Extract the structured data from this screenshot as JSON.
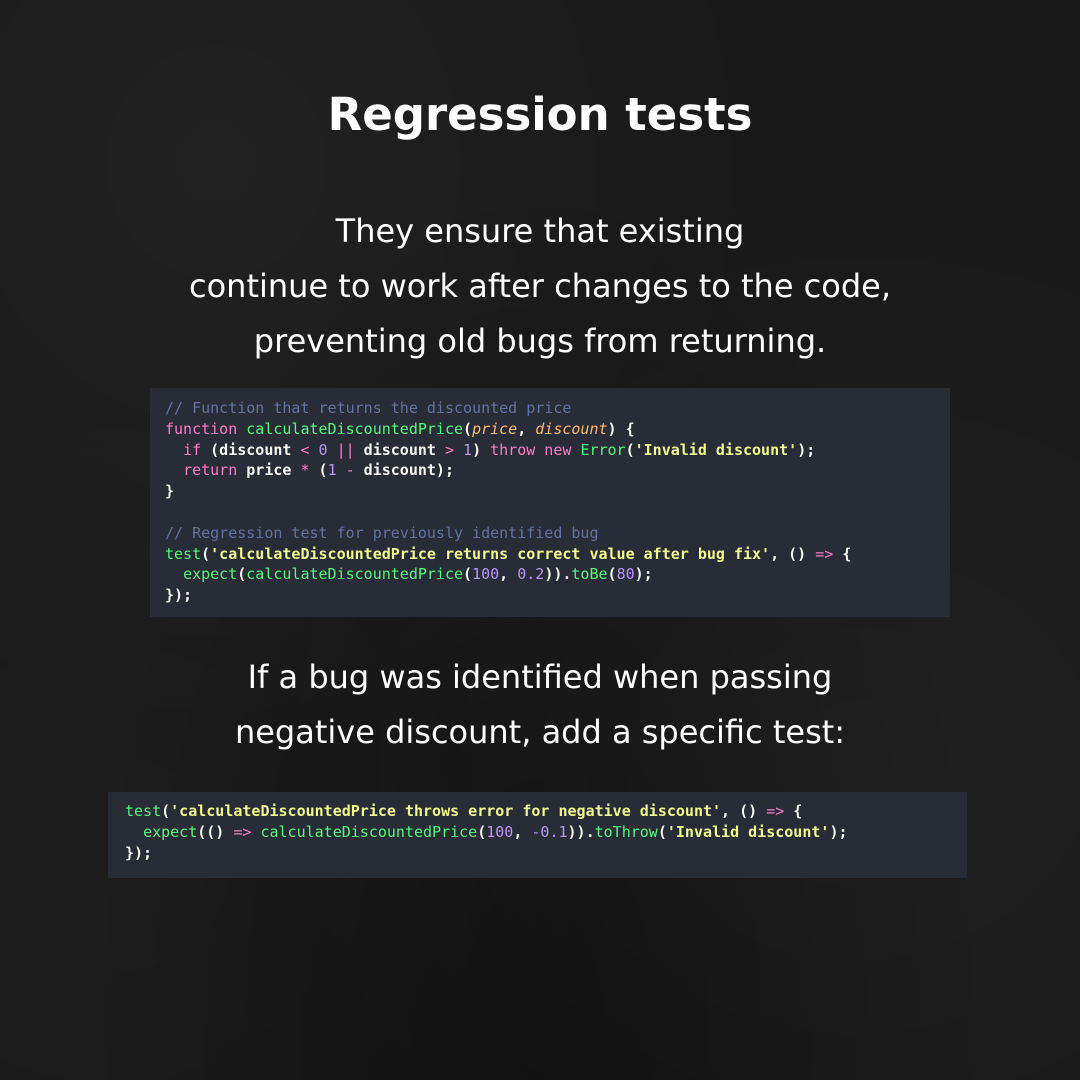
{
  "title": "Regression tests",
  "intro_lines": [
    "They ensure that existing",
    "continue to work after changes to the code,",
    "preventing old bugs from returning."
  ],
  "explain_lines": [
    "If a bug was identified when passing",
    "negative discount, add a specific test:"
  ],
  "colors": {
    "background": "#191919",
    "code_background": "#282c36",
    "comment": "#6272a4",
    "keyword": "#ff79c6",
    "function": "#50fa7b",
    "param": "#ffb86c",
    "number": "#bd93f9",
    "string": "#f1fa8c",
    "text": "#f8f8f2"
  },
  "code_blocks": [
    {
      "lines": [
        [
          [
            "c",
            "// Function that returns the discounted price"
          ]
        ],
        [
          [
            "k",
            "function "
          ],
          [
            "f",
            "calculateDiscountedPrice"
          ],
          [
            "t",
            "("
          ],
          [
            "p",
            "price"
          ],
          [
            "t",
            ", "
          ],
          [
            "p",
            "discount"
          ],
          [
            "t",
            ") {"
          ]
        ],
        [
          [
            "t",
            "  "
          ],
          [
            "k",
            "if"
          ],
          [
            "t",
            " (discount "
          ],
          [
            "k",
            "<"
          ],
          [
            "t",
            " "
          ],
          [
            "n",
            "0"
          ],
          [
            "t",
            " "
          ],
          [
            "k",
            "||"
          ],
          [
            "t",
            " discount "
          ],
          [
            "k",
            ">"
          ],
          [
            "t",
            " "
          ],
          [
            "n",
            "1"
          ],
          [
            "t",
            ") "
          ],
          [
            "k",
            "throw new "
          ],
          [
            "f",
            "Error"
          ],
          [
            "t",
            "("
          ],
          [
            "s",
            "'Invalid discount'"
          ],
          [
            "t",
            ");"
          ]
        ],
        [
          [
            "t",
            "  "
          ],
          [
            "k",
            "return"
          ],
          [
            "t",
            " price "
          ],
          [
            "k",
            "*"
          ],
          [
            "t",
            " ("
          ],
          [
            "n",
            "1"
          ],
          [
            "t",
            " "
          ],
          [
            "k",
            "-"
          ],
          [
            "t",
            " discount);"
          ]
        ],
        [
          [
            "t",
            "}"
          ]
        ],
        [
          [
            "t",
            ""
          ]
        ],
        [
          [
            "c",
            "// Regression test for previously identified bug"
          ]
        ],
        [
          [
            "f",
            "test"
          ],
          [
            "t",
            "("
          ],
          [
            "s",
            "'calculateDiscountedPrice returns correct value after bug fix'"
          ],
          [
            "t",
            ", () "
          ],
          [
            "k",
            "=>"
          ],
          [
            "t",
            " {"
          ]
        ],
        [
          [
            "t",
            "  "
          ],
          [
            "f",
            "expect"
          ],
          [
            "t",
            "("
          ],
          [
            "f",
            "calculateDiscountedPrice"
          ],
          [
            "t",
            "("
          ],
          [
            "n",
            "100"
          ],
          [
            "t",
            ", "
          ],
          [
            "n",
            "0.2"
          ],
          [
            "t",
            "))."
          ],
          [
            "f",
            "toBe"
          ],
          [
            "t",
            "("
          ],
          [
            "n",
            "80"
          ],
          [
            "t",
            ");"
          ]
        ],
        [
          [
            "t",
            "});"
          ]
        ]
      ]
    },
    {
      "lines": [
        [
          [
            "f",
            "test"
          ],
          [
            "t",
            "("
          ],
          [
            "s",
            "'calculateDiscountedPrice throws error for negative discount'"
          ],
          [
            "t",
            ", () "
          ],
          [
            "k",
            "=>"
          ],
          [
            "t",
            " {"
          ]
        ],
        [
          [
            "t",
            "  "
          ],
          [
            "f",
            "expect"
          ],
          [
            "t",
            "(() "
          ],
          [
            "k",
            "=>"
          ],
          [
            "t",
            " "
          ],
          [
            "f",
            "calculateDiscountedPrice"
          ],
          [
            "t",
            "("
          ],
          [
            "n",
            "100"
          ],
          [
            "t",
            ", "
          ],
          [
            "n",
            "-0.1"
          ],
          [
            "t",
            "))."
          ],
          [
            "f",
            "toThrow"
          ],
          [
            "t",
            "("
          ],
          [
            "s",
            "'Invalid discount'"
          ],
          [
            "t",
            ");"
          ]
        ],
        [
          [
            "t",
            "});"
          ]
        ]
      ]
    }
  ]
}
